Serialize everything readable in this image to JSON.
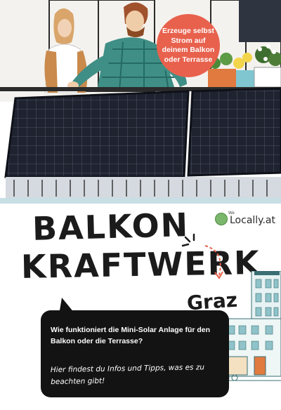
{
  "badge": {
    "text": "Erzeuge selbst\nStrom auf\ndeinem Balkon\noder Terrasse"
  },
  "title": {
    "line1": "BALKON",
    "line2": "KRAFTWERK",
    "city": "Graz"
  },
  "logo": {
    "we": "We",
    "name": "Locally.at",
    "accent_color": "#7ab66b"
  },
  "bubble": {
    "question": "Wie funktioniert die Mini-Solar Anlage für den Balkon oder die Terrasse?",
    "hint": "Hier findest du Infos und Tipps, was es zu beachten gibt!"
  },
  "colors": {
    "badge": "#e8614d",
    "bubble": "#131313",
    "title": "#1b1b1b"
  }
}
